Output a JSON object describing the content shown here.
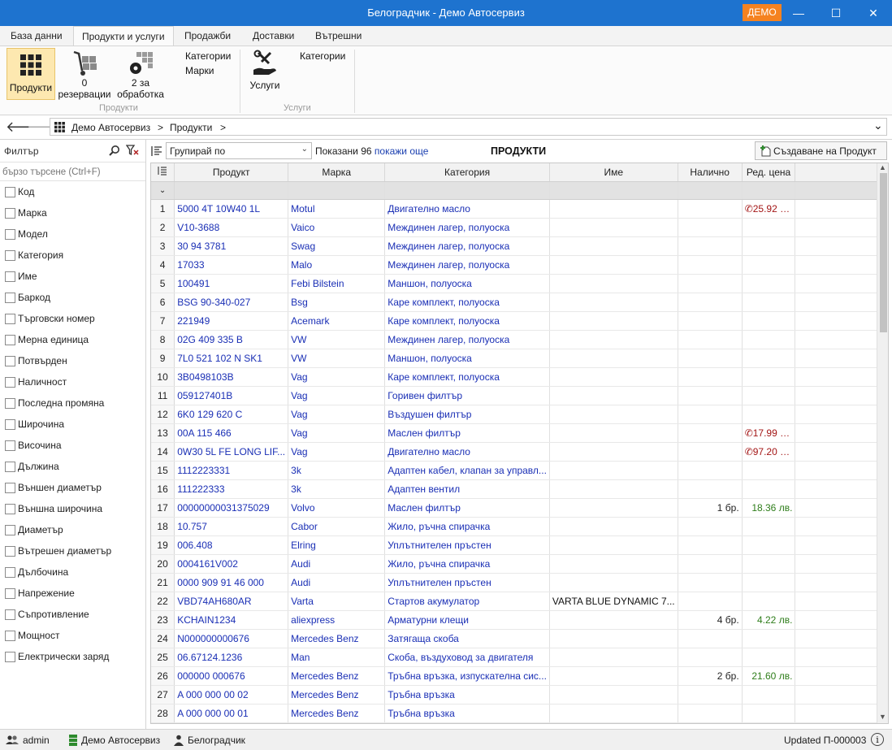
{
  "window": {
    "title": "Белоградчик - Демо Автосервиз",
    "badge": "ДЕМО",
    "minimize_glyph": "—",
    "maximize_glyph": "☐",
    "close_glyph": "✕"
  },
  "tabs": [
    {
      "label": "База данни"
    },
    {
      "label": "Продукти и услуги",
      "active": true
    },
    {
      "label": "Продажби"
    },
    {
      "label": "Доставки"
    },
    {
      "label": "Вътрешни"
    }
  ],
  "ribbon": {
    "products_button": "Продукти",
    "reservations_line1": "0",
    "reservations_line2": "резервации",
    "processing_line1": "2 за",
    "processing_line2": "обработка",
    "products_categories": "Категории",
    "products_brands": "Марки",
    "products_group": "Продукти",
    "services_button": "Услуги",
    "services_categories": "Категории",
    "services_group": "Услуги"
  },
  "nav": {
    "back_glyph": "🡐",
    "forward_glyph": "🡒",
    "crumb_root": "Демо Автосервиз",
    "crumb_sep1": ">",
    "crumb_page": "Продукти",
    "crumb_sep2": ">",
    "dropdown_glyph": "⌄"
  },
  "filter": {
    "label": "Филтър",
    "quick_search_placeholder": "бързо търсене (Ctrl+F)",
    "fields": [
      "Код",
      "Марка",
      "Модел",
      "Категория",
      "Име",
      "Баркод",
      "Търговски номер",
      "Мерна единица",
      "Потвърден",
      "Наличност",
      "Последна промяна",
      "Широчина",
      "Височина",
      "Дължина",
      "Външен диаметър",
      "Външна широчина",
      "Диаметър",
      "Вътрешен диаметър",
      "Дълбочина",
      "Напрежение",
      "Съпротивление",
      "Мощност",
      "Електрически заряд"
    ]
  },
  "main": {
    "group_by": "Групирай по",
    "shown_text": "Показани 96",
    "show_more": "покажи още",
    "title": "ПРОДУКТИ",
    "create_button": "Създаване на Продукт"
  },
  "columns": [
    "Продукт",
    "Марка",
    "Категория",
    "Име",
    "Налично",
    "Ред. цена"
  ],
  "rows": [
    {
      "n": "1",
      "code": "5000 4T 10W40 1L",
      "brand": "Motul",
      "category": "Двигателно масло",
      "name": "",
      "qty": "",
      "price": "25.92 лв.",
      "price_color": "red",
      "phone": true
    },
    {
      "n": "2",
      "code": "V10-3688",
      "brand": "Vaico",
      "category": "Междинен лагер, полуоска",
      "name": "",
      "qty": "",
      "price": "",
      "price_color": "",
      "phone": false
    },
    {
      "n": "3",
      "code": "30 94 3781",
      "brand": "Swag",
      "category": "Междинен лагер, полуоска",
      "name": "",
      "qty": "",
      "price": "",
      "price_color": "",
      "phone": false
    },
    {
      "n": "4",
      "code": "17033",
      "brand": "Malo",
      "category": "Междинен лагер, полуоска",
      "name": "",
      "qty": "",
      "price": "",
      "price_color": "",
      "phone": false
    },
    {
      "n": "5",
      "code": "100491",
      "brand": "Febi Bilstein",
      "category": "Маншон, полуоска",
      "name": "",
      "qty": "",
      "price": "",
      "price_color": "",
      "phone": false
    },
    {
      "n": "6",
      "code": "BSG 90-340-027",
      "brand": "Bsg",
      "category": "Каре комплект, полуоска",
      "name": "",
      "qty": "",
      "price": "",
      "price_color": "",
      "phone": false
    },
    {
      "n": "7",
      "code": "221949",
      "brand": "Acemark",
      "category": "Каре комплект, полуоска",
      "name": "",
      "qty": "",
      "price": "",
      "price_color": "",
      "phone": false
    },
    {
      "n": "8",
      "code": "02G 409 335 B",
      "brand": "VW",
      "category": "Междинен лагер, полуоска",
      "name": "",
      "qty": "",
      "price": "",
      "price_color": "",
      "phone": false
    },
    {
      "n": "9",
      "code": "7L0 521 102 N SK1",
      "brand": "VW",
      "category": "Маншон, полуоска",
      "name": "",
      "qty": "",
      "price": "",
      "price_color": "",
      "phone": false
    },
    {
      "n": "10",
      "code": "3B0498103B",
      "brand": "Vag",
      "category": "Каре комплект, полуоска",
      "name": "",
      "qty": "",
      "price": "",
      "price_color": "",
      "phone": false
    },
    {
      "n": "11",
      "code": "059127401B",
      "brand": "Vag",
      "category": "Горивен филтър",
      "name": "",
      "qty": "",
      "price": "",
      "price_color": "",
      "phone": false
    },
    {
      "n": "12",
      "code": "6K0 129 620 C",
      "brand": "Vag",
      "category": "Въздушен филтър",
      "name": "",
      "qty": "",
      "price": "",
      "price_color": "",
      "phone": false
    },
    {
      "n": "13",
      "code": "00A 115 466",
      "brand": "Vag",
      "category": "Маслен филтър",
      "name": "",
      "qty": "",
      "price": "17.99 лв.",
      "price_color": "red",
      "phone": true
    },
    {
      "n": "14",
      "code": "0W30 5L FE LONG LIF...",
      "brand": "Vag",
      "category": "Двигателно масло",
      "name": "",
      "qty": "",
      "price": "97.20 лв.",
      "price_color": "red",
      "phone": true
    },
    {
      "n": "15",
      "code": "1112223331",
      "brand": "3k",
      "category": "Адаптен кабел, клапан за управл...",
      "name": "",
      "qty": "",
      "price": "",
      "price_color": "",
      "phone": false
    },
    {
      "n": "16",
      "code": "111222333",
      "brand": "3k",
      "category": "Адаптен вентил",
      "name": "",
      "qty": "",
      "price": "",
      "price_color": "",
      "phone": false
    },
    {
      "n": "17",
      "code": "00000000031375029",
      "brand": "Volvo",
      "category": "Маслен филтър",
      "name": "",
      "qty": "1 бр.",
      "price": "18.36 лв.",
      "price_color": "green",
      "phone": false
    },
    {
      "n": "18",
      "code": "10.757",
      "brand": "Cabor",
      "category": "Жило, ръчна спирачка",
      "name": "",
      "qty": "",
      "price": "",
      "price_color": "",
      "phone": false
    },
    {
      "n": "19",
      "code": "006.408",
      "brand": "Elring",
      "category": "Уплътнителен пръстен",
      "name": "",
      "qty": "",
      "price": "",
      "price_color": "",
      "phone": false
    },
    {
      "n": "20",
      "code": "0004161V002",
      "brand": "Audi",
      "category": "Жило, ръчна спирачка",
      "name": "",
      "qty": "",
      "price": "",
      "price_color": "",
      "phone": false
    },
    {
      "n": "21",
      "code": "0000 909 91 46 000",
      "brand": "Audi",
      "category": "Уплътнителен пръстен",
      "name": "",
      "qty": "",
      "price": "",
      "price_color": "",
      "phone": false
    },
    {
      "n": "22",
      "code": "VBD74AH680AR",
      "brand": "Varta",
      "category": "Стартов акумулатор",
      "name": "VARTA BLUE DYNAMIC 7...",
      "qty": "",
      "price": "",
      "price_color": "",
      "phone": false
    },
    {
      "n": "23",
      "code": "KCHAIN1234",
      "brand": "aliexpress",
      "category": "Арматурни клещи",
      "name": "",
      "qty": "4 бр.",
      "price": "4.22 лв.",
      "price_color": "green",
      "phone": false
    },
    {
      "n": "24",
      "code": "N000000000676",
      "brand": "Mercedes Benz",
      "category": "Затягаща скоба",
      "name": "",
      "qty": "",
      "price": "",
      "price_color": "",
      "phone": false
    },
    {
      "n": "25",
      "code": "06.67124.1236",
      "brand": "Man",
      "category": "Скоба, въздуховод за двигателя",
      "name": "",
      "qty": "",
      "price": "",
      "price_color": "",
      "phone": false
    },
    {
      "n": "26",
      "code": "000000 000676",
      "brand": "Mercedes Benz",
      "category": "Тръбна връзка, изпускателна сис...",
      "name": "",
      "qty": "2 бр.",
      "price": "21.60 лв.",
      "price_color": "green",
      "phone": false
    },
    {
      "n": "27",
      "code": "A 000 000 00 02",
      "brand": "Mercedes Benz",
      "category": "Тръбна връзка",
      "name": "",
      "qty": "",
      "price": "",
      "price_color": "",
      "phone": false
    },
    {
      "n": "28",
      "code": "A 000 000 00 01",
      "brand": "Mercedes Benz",
      "category": "Тръбна връзка",
      "name": "",
      "qty": "",
      "price": "",
      "price_color": "",
      "phone": false
    }
  ],
  "status": {
    "user": "admin",
    "company": "Демо Автосервиз",
    "location": "Белоградчик",
    "updated": "Updated П-000003"
  },
  "colors": {
    "titlebar": "#1e73cf",
    "demo_badge": "#f58220",
    "link": "#1a2fb5",
    "price_red": "#a31515",
    "price_green": "#2e7d1a"
  }
}
